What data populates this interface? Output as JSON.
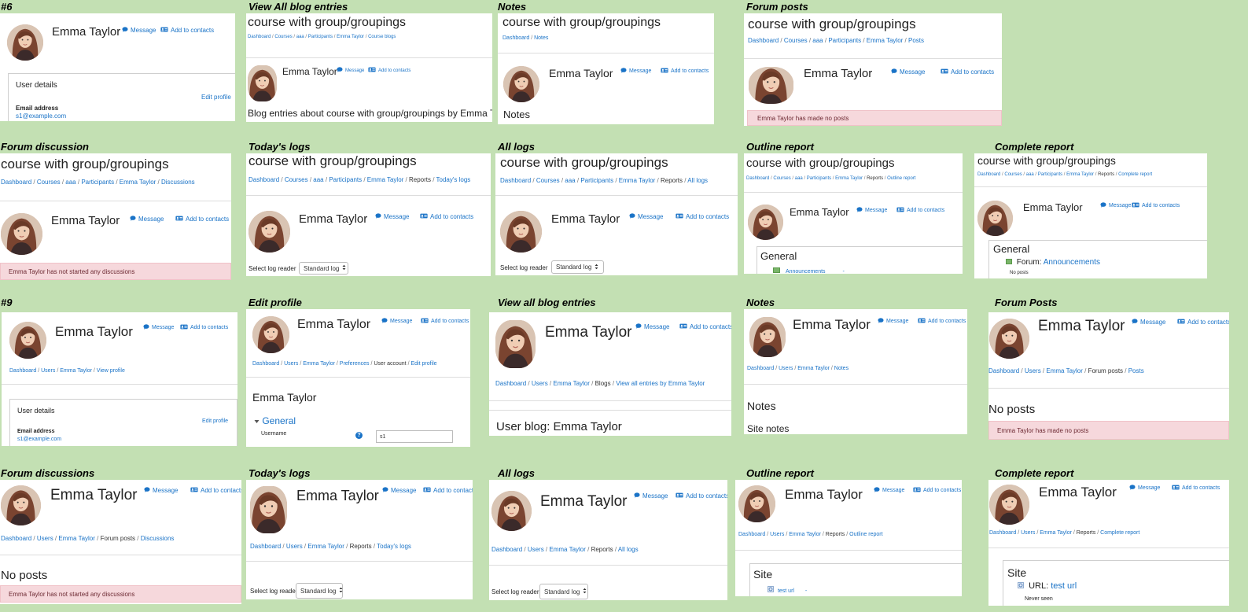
{
  "user": {
    "name": "Emma Taylor",
    "message": "Message",
    "add_contacts": "Add to contacts",
    "email": "s1@example.com"
  },
  "common": {
    "course": "course with group/groupings",
    "dashboard": "Dashboard",
    "courses": "Courses",
    "aaa": "aaa",
    "participants": "Participants",
    "users": "Users",
    "reports": "Reports",
    "forum_posts": "Forum posts",
    "posts": "Posts",
    "discussions": "Discussions",
    "todays_logs": "Today's logs",
    "all_logs": "All logs",
    "outline_report": "Outline report",
    "complete_report": "Complete report",
    "user_details": "User details",
    "edit_profile": "Edit profile",
    "email_address": "Email address",
    "view_profile": "View profile",
    "notes": "Notes",
    "site_notes": "Site notes",
    "no_posts": "No posts",
    "made_no_posts": "Emma Taylor has made no posts",
    "no_discussions": "Emma Taylor has not started any discussions",
    "select_log_reader": "Select log reader",
    "standard_log": "Standard log",
    "general": "General",
    "site": "Site",
    "course_blogs": "Course blogs",
    "blog_entries_about": "Blog entries about course with group/groupings by Emma Taylor",
    "preferences": "Preferences",
    "user_account": "User account",
    "username_label": "Username",
    "username_value": "s1",
    "blogs": "Blogs",
    "view_all_entries_by": "View all entries by Emma Taylor",
    "user_blog": "User blog: Emma Taylor",
    "forum_label": "Forum:",
    "announcements": "Announcements",
    "dash": "-",
    "url_label": "URL:",
    "test_url": "test url",
    "never_seen": "Never seen"
  },
  "labels": {
    "l1": "#6",
    "l2": "View All blog entries",
    "l3": "Notes",
    "l4": "Forum posts",
    "l5": "Forum discussion",
    "l6": "Today's logs",
    "l7": "All logs",
    "l8": "Outline report",
    "l9": "Complete report",
    "l10": "#9",
    "l11": "Edit profile",
    "l12": "View all blog entries",
    "l13": "Notes",
    "l14": "Forum Posts",
    "l15": "Forum discussions",
    "l16": "Today's logs",
    "l17": "All logs",
    "l18": "Outline report",
    "l19": "Complete report"
  },
  "colors": {
    "background": "#c3e0b3",
    "link": "#1a73c7",
    "alert_bg": "#f6d8dc",
    "alert_text": "#6d2a33"
  },
  "icons": {
    "avatar": "profile-photo",
    "message": "speech-bubble-icon",
    "contacts": "address-card-icon",
    "forum": "forum-icon",
    "url": "url-icon",
    "help": "help-icon",
    "select": "select-arrows-icon",
    "caret": "caret-down-icon"
  }
}
